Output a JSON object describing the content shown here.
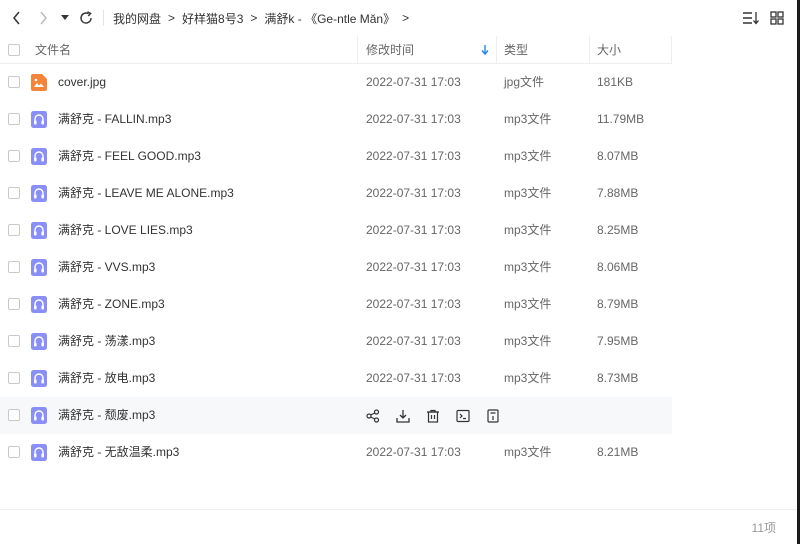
{
  "breadcrumb": [
    "我的网盘",
    "好样猫8号3",
    "满舒k - 《Ge-ntle Măn》"
  ],
  "breadcrumb_separator": ">",
  "columns": {
    "name": "文件名",
    "modified": "修改时间",
    "type": "类型",
    "size": "大小"
  },
  "files": [
    {
      "name": "cover.jpg",
      "modified": "2022-07-31 17:03",
      "type": "jpg文件",
      "size": "181KB",
      "icon": "image-file-icon"
    },
    {
      "name": "满舒克 - FALLIN.mp3",
      "modified": "2022-07-31 17:03",
      "type": "mp3文件",
      "size": "11.79MB",
      "icon": "audio-file-icon"
    },
    {
      "name": "满舒克 - FEEL GOOD.mp3",
      "modified": "2022-07-31 17:03",
      "type": "mp3文件",
      "size": "8.07MB",
      "icon": "audio-file-icon"
    },
    {
      "name": "满舒克 - LEAVE ME ALONE.mp3",
      "modified": "2022-07-31 17:03",
      "type": "mp3文件",
      "size": "7.88MB",
      "icon": "audio-file-icon"
    },
    {
      "name": "满舒克 - LOVE LIES.mp3",
      "modified": "2022-07-31 17:03",
      "type": "mp3文件",
      "size": "8.25MB",
      "icon": "audio-file-icon"
    },
    {
      "name": "满舒克 - VVS.mp3",
      "modified": "2022-07-31 17:03",
      "type": "mp3文件",
      "size": "8.06MB",
      "icon": "audio-file-icon"
    },
    {
      "name": "满舒克 - ZONE.mp3",
      "modified": "2022-07-31 17:03",
      "type": "mp3文件",
      "size": "8.79MB",
      "icon": "audio-file-icon"
    },
    {
      "name": "满舒克 - 荡漾.mp3",
      "modified": "2022-07-31 17:03",
      "type": "mp3文件",
      "size": "7.95MB",
      "icon": "audio-file-icon"
    },
    {
      "name": "满舒克 - 放电.mp3",
      "modified": "2022-07-31 17:03",
      "type": "mp3文件",
      "size": "8.73MB",
      "icon": "audio-file-icon"
    },
    {
      "name": "满舒克 - 颓废.mp3",
      "modified": "",
      "type": "",
      "size": "",
      "icon": "audio-file-icon",
      "hovered": true
    },
    {
      "name": "满舒克 - 无敌温柔.mp3",
      "modified": "2022-07-31 17:03",
      "type": "mp3文件",
      "size": "8.21MB",
      "icon": "audio-file-icon"
    }
  ],
  "row_actions": [
    "share-icon",
    "download-icon",
    "delete-icon",
    "rename-icon",
    "more-icon"
  ],
  "footer": {
    "count": "11项"
  },
  "colors": {
    "accent": "#1e88e5",
    "image_icon": "#f5843b",
    "audio_icon": "#8a8ff7"
  }
}
